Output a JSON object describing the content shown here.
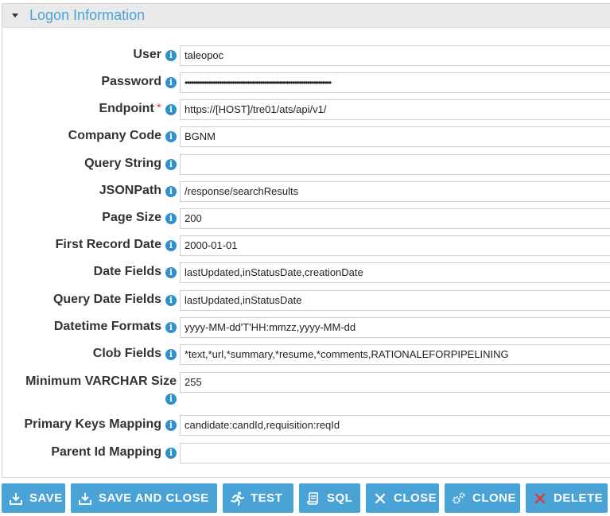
{
  "section": {
    "title": "Logon Information"
  },
  "fields": [
    {
      "label": "User",
      "value": "taleopoc"
    },
    {
      "label": "Password",
      "value": "••••••••••••••••••••••••••••••••••••••••••••••••••••••••••••••••••••"
    },
    {
      "label": "Endpoint",
      "value": "https://[HOST]/tre01/ats/api/v1/",
      "required_mark": "*"
    },
    {
      "label": "Company Code",
      "value": "BGNM"
    },
    {
      "label": "Query String",
      "value": ""
    },
    {
      "label": "JSONPath",
      "value": "/response/searchResults"
    },
    {
      "label": "Page Size",
      "value": "200"
    },
    {
      "label": "First Record Date",
      "value": "2000-01-01"
    },
    {
      "label": "Date Fields",
      "value": "lastUpdated,inStatusDate,creationDate"
    },
    {
      "label": "Query Date Fields",
      "value": "lastUpdated,inStatusDate"
    },
    {
      "label": "Datetime Formats",
      "value": "yyyy-MM-dd'T'HH:mmzz,yyyy-MM-dd"
    },
    {
      "label": "Clob Fields",
      "value": "*text,*url,*summary,*resume,*comments,RATIONALEFORPIPELINING"
    },
    {
      "label": "Minimum VARCHAR Size",
      "value": "255"
    },
    {
      "label": "Primary Keys Mapping",
      "value": "candidate:candId,requisition:reqId"
    },
    {
      "label": "Parent Id Mapping",
      "value": ""
    }
  ],
  "info_glyph": "i",
  "buttons": {
    "save": "SAVE",
    "save_close": "SAVE AND CLOSE",
    "test": "TEST",
    "sql": "SQL",
    "close": "CLOSE",
    "clone": "CLONE",
    "delete": "DELETE"
  },
  "colors": {
    "accent": "#4aa3d6",
    "info": "#2f8fcf",
    "required": "#e04b4b",
    "delete_icon": "#e03b3b"
  }
}
